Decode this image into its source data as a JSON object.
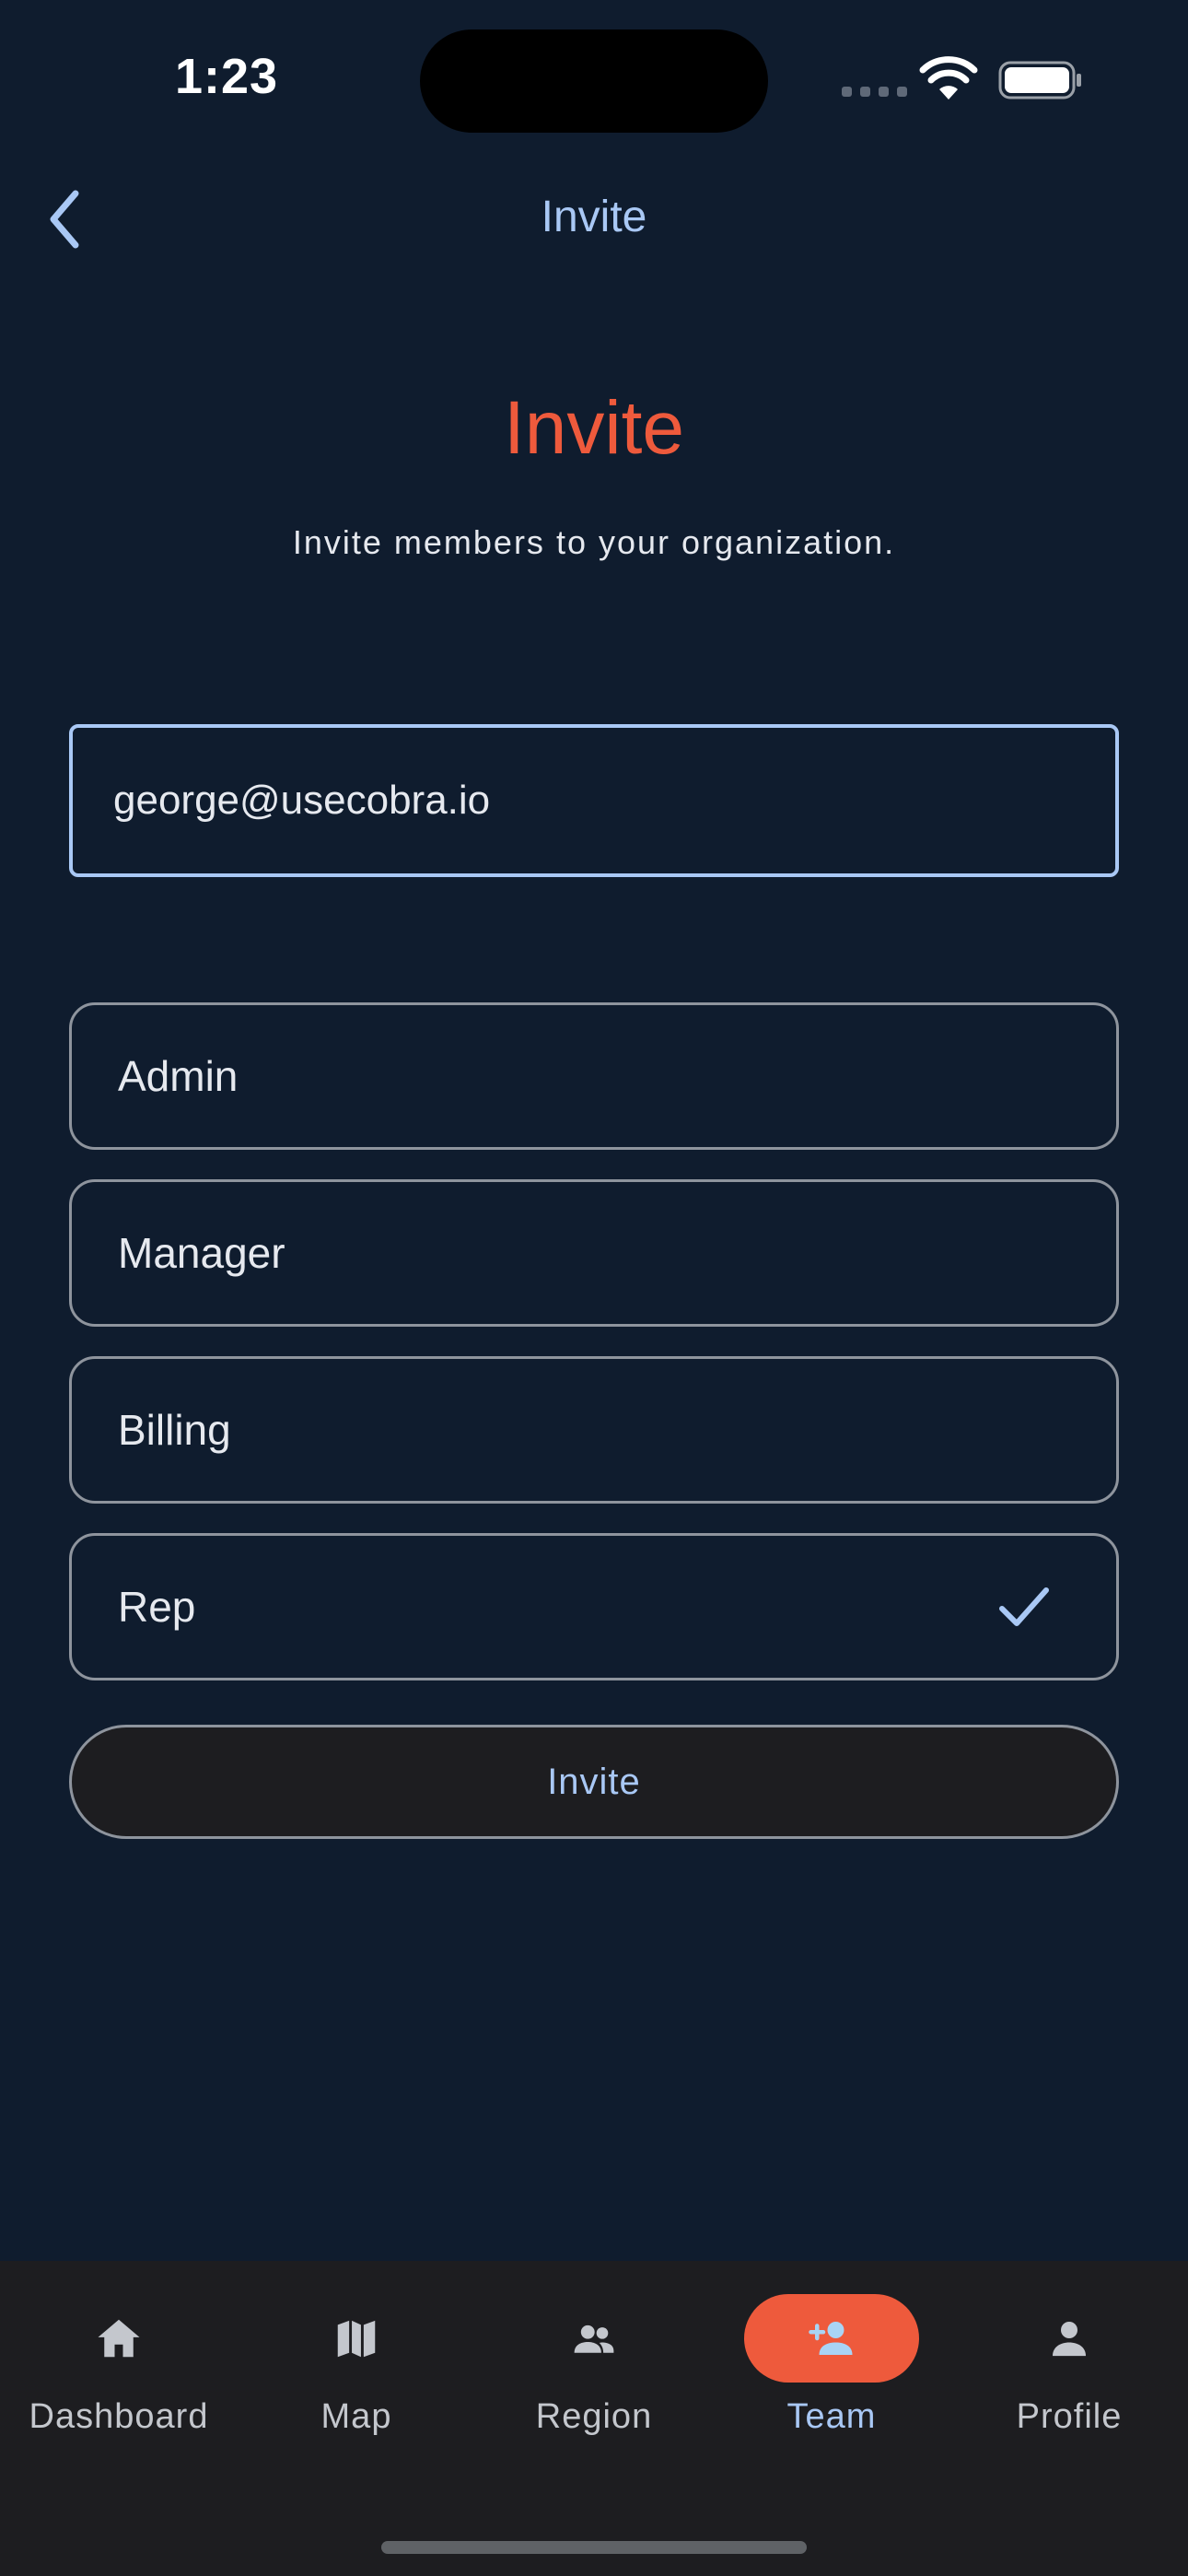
{
  "status_bar": {
    "time": "1:23"
  },
  "header": {
    "title": "Invite"
  },
  "main": {
    "title": "Invite",
    "subtitle": "Invite members to your organization.",
    "email_value": "george@usecobra.io",
    "roles": [
      {
        "label": "Admin",
        "selected": false
      },
      {
        "label": "Manager",
        "selected": false
      },
      {
        "label": "Billing",
        "selected": false
      },
      {
        "label": "Rep",
        "selected": true
      }
    ],
    "invite_button_label": "Invite"
  },
  "tab_bar": {
    "tabs": [
      {
        "label": "Dashboard",
        "icon": "home-icon",
        "active": false
      },
      {
        "label": "Map",
        "icon": "map-icon",
        "active": false
      },
      {
        "label": "Region",
        "icon": "group-icon",
        "active": false
      },
      {
        "label": "Team",
        "icon": "person-add-icon",
        "active": true
      },
      {
        "label": "Profile",
        "icon": "person-icon",
        "active": false
      }
    ]
  },
  "colors": {
    "background": "#0f1c2e",
    "accent_orange": "#ee5a3c",
    "accent_blue": "#a9c8f5",
    "tab_bar_bg": "#1d1d20"
  }
}
